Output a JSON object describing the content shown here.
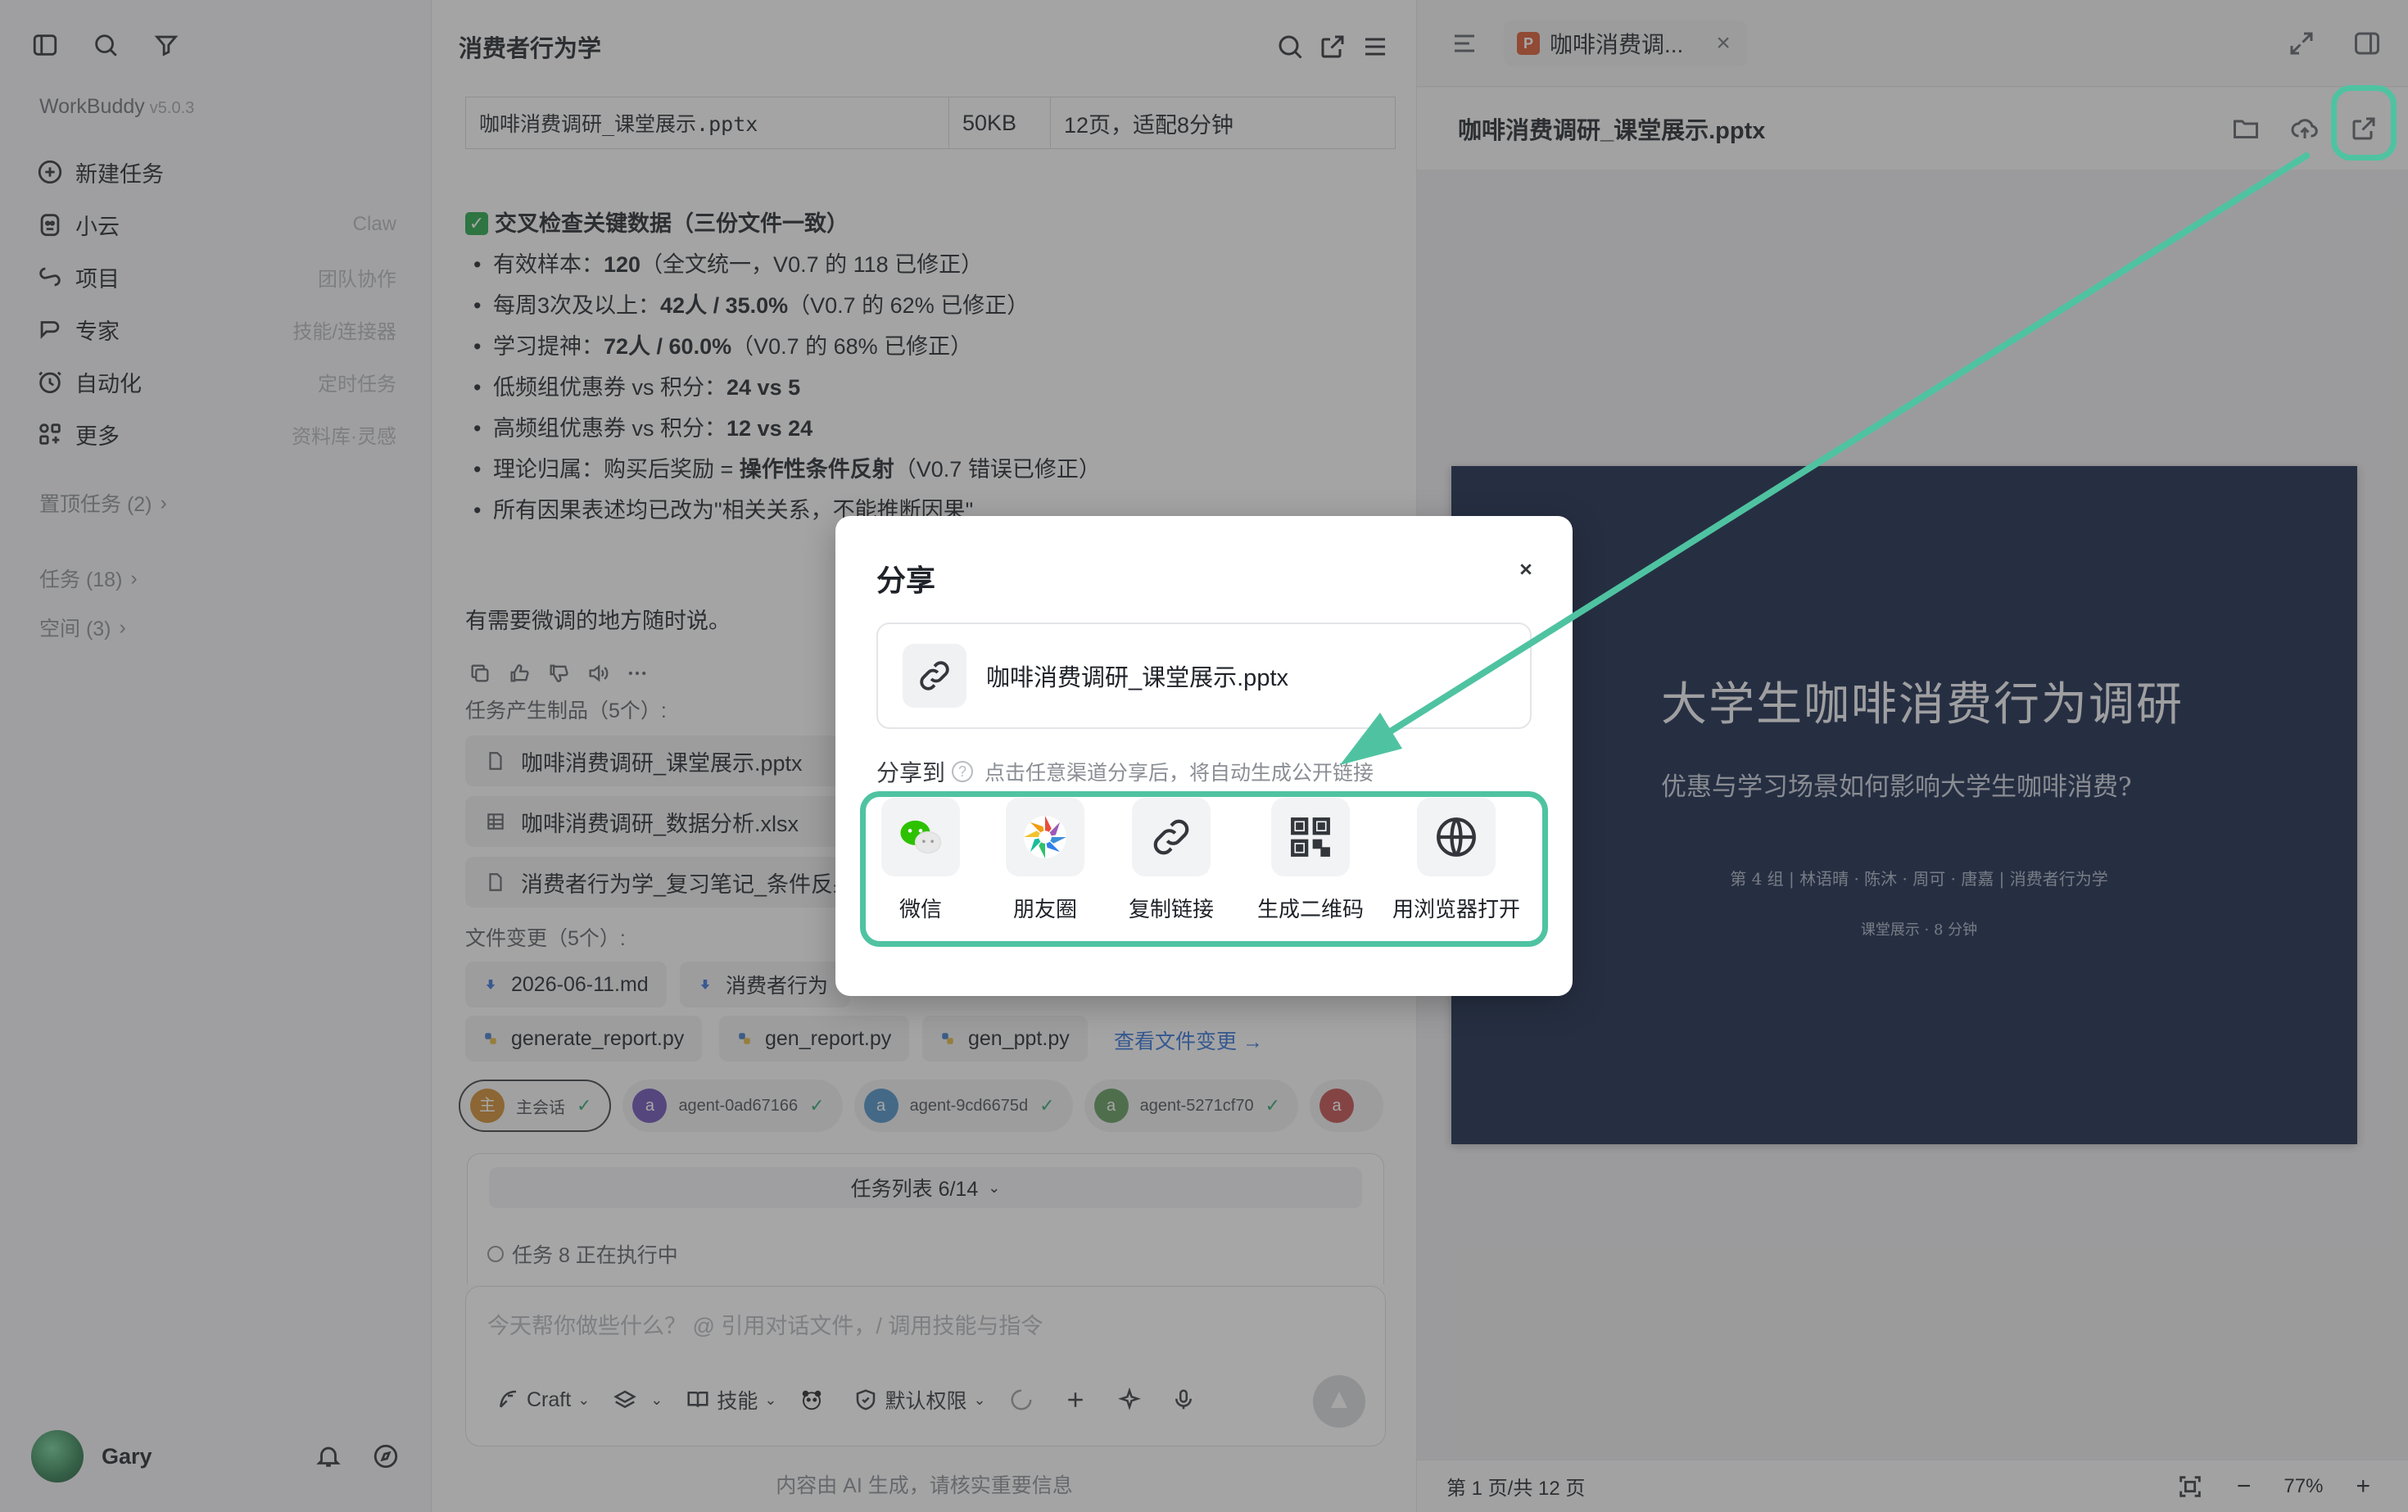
{
  "sidebar": {
    "brand": "WorkBuddy",
    "version": "v5.0.3",
    "menu": [
      {
        "label": "新建任务",
        "hint": ""
      },
      {
        "label": "小云",
        "hint": "Claw"
      },
      {
        "label": "项目",
        "hint": "团队协作"
      },
      {
        "label": "专家",
        "hint": "技能/连接器"
      },
      {
        "label": "自动化",
        "hint": "定时任务"
      },
      {
        "label": "更多",
        "hint": "资料库·灵感"
      }
    ],
    "pinned": "置顶任务 (2)",
    "tasks": "任务 (18)",
    "spaces": "空间 (3)",
    "user": "Gary"
  },
  "chat": {
    "title": "消费者行为学",
    "file_row": {
      "name": "咖啡消费调研_课堂展示.pptx",
      "size": "50KB",
      "note": "12页，适配8分钟"
    },
    "check_title": "交叉检查关键数据（三份文件一致）",
    "bullets": [
      {
        "pre": "有效样本：",
        "bold": "120",
        "post": "（全文统一，V0.7 的 118 已修正）"
      },
      {
        "pre": "每周3次及以上：",
        "bold": "42人 / 35.0%",
        "post": "（V0.7 的 62% 已修正）"
      },
      {
        "pre": "学习提神：",
        "bold": "72人 / 60.0%",
        "post": "（V0.7 的 68% 已修正）"
      },
      {
        "pre": "低频组优惠券 vs 积分：",
        "bold": "24 vs 5",
        "post": ""
      },
      {
        "pre": "高频组优惠券 vs 积分：",
        "bold": "12 vs 24",
        "post": ""
      },
      {
        "pre": "理论归属：购买后奖励 = ",
        "bold": "操作性条件反射",
        "post": "（V0.7 错误已修正）"
      },
      {
        "pre": "所有因果表述均已改为\"相关关系，不能推断因果\"",
        "bold": "",
        "post": ""
      }
    ],
    "reply": "有需要微调的地方随时说。",
    "artifacts_title": "任务产生制品（5个）:",
    "artifacts": [
      "咖啡消费调研_课堂展示.pptx",
      "咖啡消费调研_数据分析.xlsx",
      "消费者行为学_复习笔记_条件反射"
    ],
    "changes_title": "文件变更（5个）:",
    "changes": [
      "2026-06-11.md",
      "消费者行为",
      "generate_report.py",
      "gen_report.py",
      "gen_ppt.py"
    ],
    "changes_link": "查看文件变更 →",
    "agents": [
      {
        "av": "主",
        "name": "主会话",
        "color": "#d08a2e"
      },
      {
        "av": "a",
        "name": "agent-0ad67166",
        "color": "#6a4fb6"
      },
      {
        "av": "a",
        "name": "agent-9cd6675d",
        "color": "#4a8fc4"
      },
      {
        "av": "a",
        "name": "agent-5271cf70",
        "color": "#5f9a5a"
      },
      {
        "av": "a",
        "name": "",
        "color": "#c24a4a"
      }
    ],
    "task_list": "任务列表 6/14",
    "task_running": "任务 8 正在执行中",
    "input_placeholder": "今天帮你做些什么？ @ 引用对话文件，/ 调用技能与指令",
    "toolbar": {
      "craft": "Craft",
      "skills": "技能",
      "permission": "默认权限"
    },
    "footnote": "内容由 AI 生成，请核实重要信息"
  },
  "preview": {
    "tab": "咖啡消费调...",
    "filename": "咖啡消费调研_课堂展示.pptx",
    "slide": {
      "title": "大学生咖啡消费行为调研",
      "subtitle": "优惠与学习场景如何影响大学生咖啡消费?",
      "meta": "第 4 组  |  林语晴 · 陈沐 · 周可 · 唐嘉  |  消费者行为学",
      "note": "课堂展示 · 8 分钟"
    },
    "page": "第 1 页/共 12 页",
    "zoom": "77%"
  },
  "dialog": {
    "title": "分享",
    "file": "咖啡消费调研_课堂展示.pptx",
    "share_to": "分享到",
    "tip": "点击任意渠道分享后，将自动生成公开链接",
    "channels": [
      "微信",
      "朋友圈",
      "复制链接",
      "生成二维码",
      "用浏览器打开"
    ]
  },
  "colors": {
    "highlight": "#4fc3a1",
    "slide_bg": "#142446",
    "link": "#2f6fd6"
  }
}
